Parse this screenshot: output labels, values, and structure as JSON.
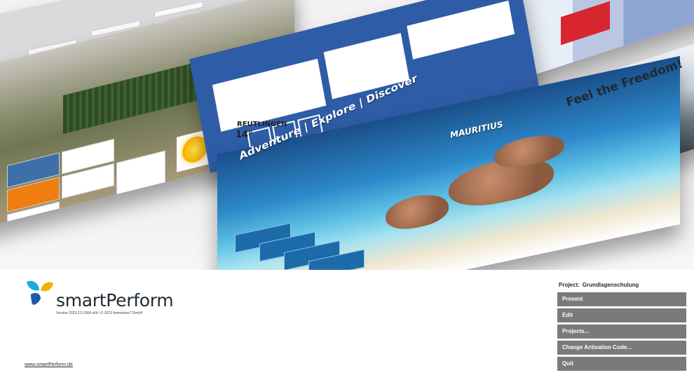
{
  "hero": {
    "island_title": "Adventure | Explore | Discover",
    "island_place": "MAURITIUS",
    "car_slogan": "Feel the Freedom!",
    "city_name": "REUTLINGEN",
    "city_temp": "14°"
  },
  "brand": {
    "name": "smartPerform",
    "version": "Version 2023.3.0.3004 x64 / © 2023 Immersion7 GmbH",
    "website": "www.smartPerform.de",
    "logo_colors": [
      "#1aa9e0",
      "#f0b400",
      "#1f5aa6"
    ]
  },
  "project": {
    "label": "Project:",
    "name": "Grundlagenschulung"
  },
  "menu": {
    "present": "Present",
    "edit": "Edit",
    "projects": "Projects...",
    "change_activation": "Change Activation Code...",
    "quit": "Quit"
  },
  "colors": {
    "button_bg": "#7a7a7a",
    "accent_blue": "#2f5ca6"
  }
}
